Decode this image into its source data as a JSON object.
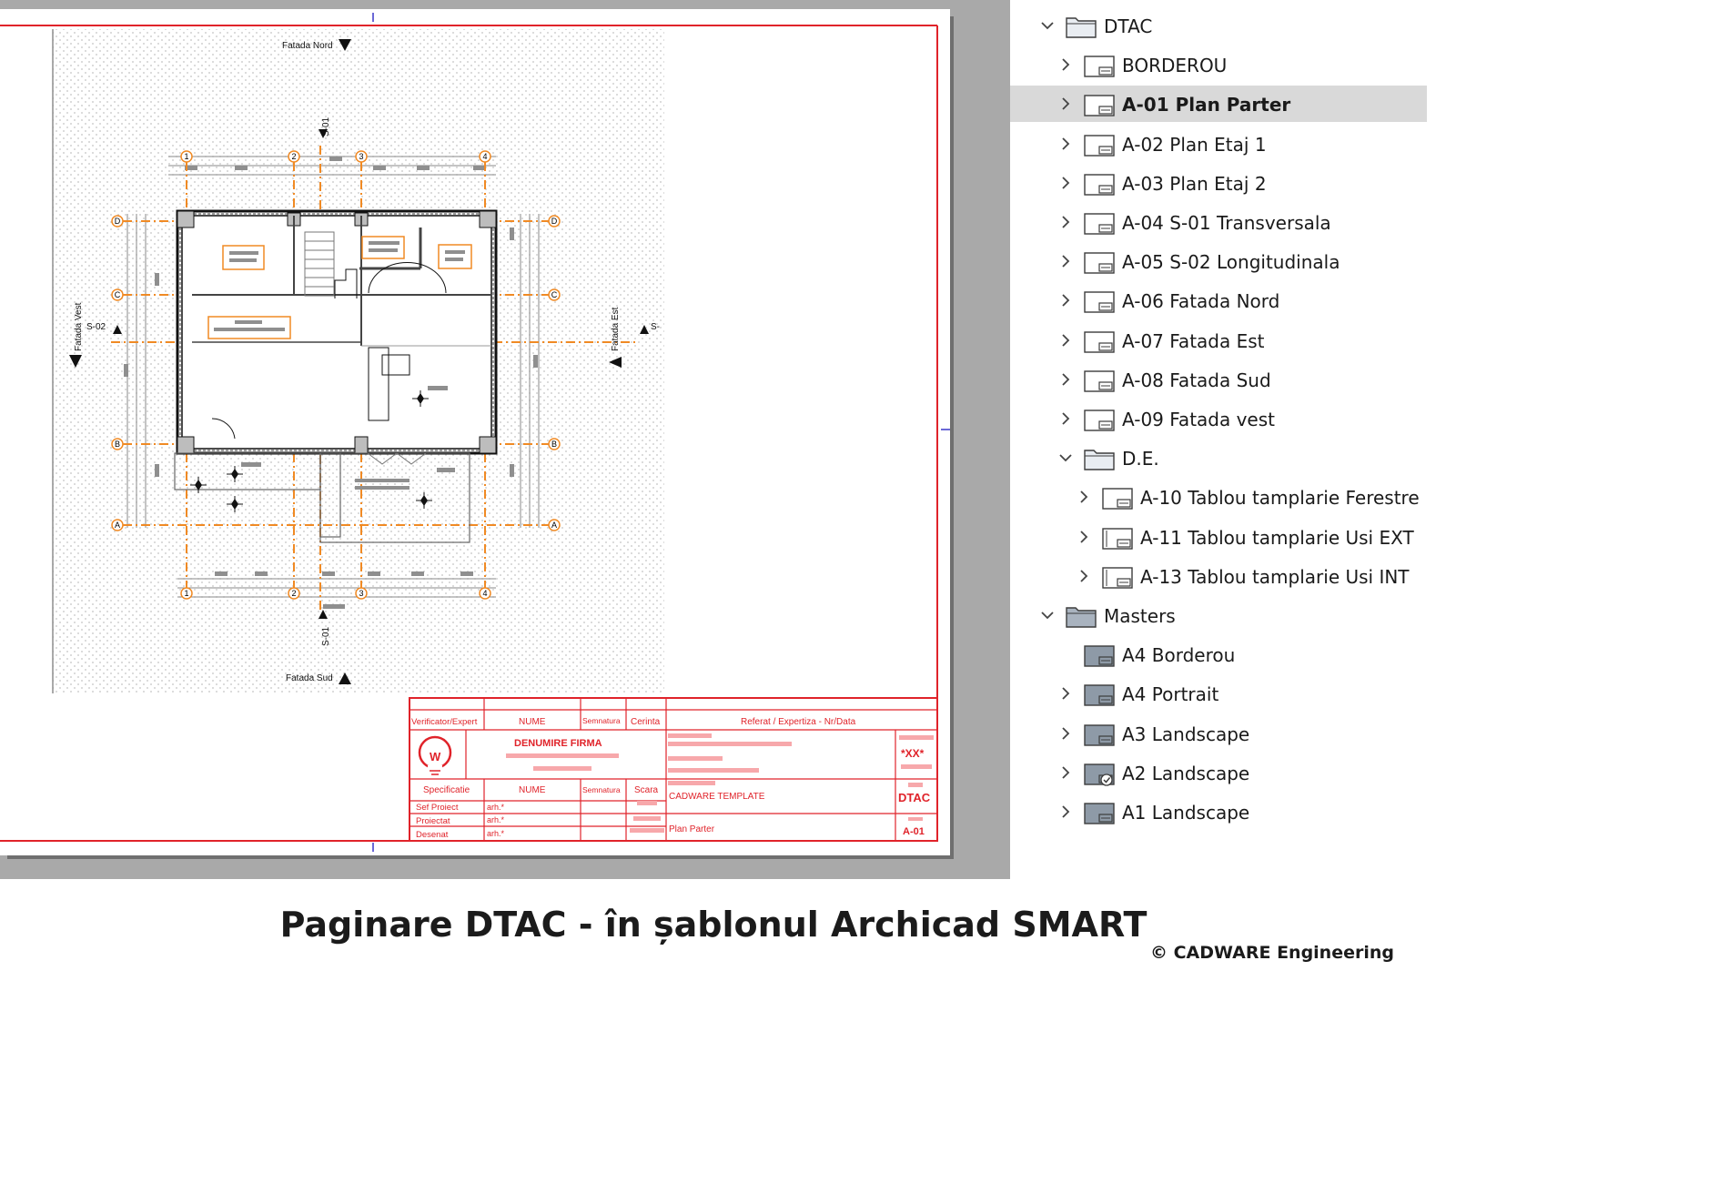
{
  "plan": {
    "elevations": {
      "north": "Fatada Nord",
      "south": "Fatada Sud",
      "east": "Fatada Est",
      "west": "Fatada Vest"
    },
    "sections": {
      "s01": "S-01",
      "s02": "S-02",
      "s_right": "S-"
    },
    "grid_numbers": [
      "1",
      "2",
      "3",
      "4"
    ],
    "grid_letters": [
      "A",
      "B",
      "C",
      "D"
    ]
  },
  "title_block": {
    "verificator": "Verificator/Expert",
    "nume": "NUME",
    "semnatura": "Semnatura",
    "cerinta": "Cerinta",
    "referat": "Referat / Expertiza - Nr/Data",
    "firm_name": "DENUMIRE FIRMA",
    "logo_letter": "W",
    "code": "*XX*",
    "specificatie": "Specificatie",
    "scara": "Scara",
    "template": "CADWARE TEMPLATE",
    "project_code": "DTAC",
    "roles": [
      {
        "role": "Sef Proiect",
        "name": "arh.*"
      },
      {
        "role": "Proiectat",
        "name": "arh.*"
      },
      {
        "role": "Desenat",
        "name": "arh.*"
      }
    ],
    "sheet_title": "Plan Parter",
    "sheet_number": "A-01"
  },
  "tree": [
    {
      "label": "DTAC",
      "icon": "folder-icon",
      "expanded": true,
      "selected": false
    },
    {
      "label": "BORDEROU",
      "icon": "layout-icon",
      "expanded": false,
      "selected": false
    },
    {
      "label": "A-01 Plan Parter",
      "icon": "layout-icon",
      "expanded": false,
      "selected": true
    },
    {
      "label": "A-02 Plan Etaj 1",
      "icon": "layout-icon",
      "expanded": false,
      "selected": false
    },
    {
      "label": "A-03 Plan Etaj 2",
      "icon": "layout-icon",
      "expanded": false,
      "selected": false
    },
    {
      "label": "A-04 S-01 Transversala",
      "icon": "layout-icon",
      "expanded": false,
      "selected": false
    },
    {
      "label": "A-05 S-02 Longitudinala",
      "icon": "layout-icon",
      "expanded": false,
      "selected": false
    },
    {
      "label": "A-06 Fatada Nord",
      "icon": "layout-icon",
      "expanded": false,
      "selected": false
    },
    {
      "label": "A-07 Fatada Est",
      "icon": "layout-icon",
      "expanded": false,
      "selected": false
    },
    {
      "label": "A-08 Fatada Sud",
      "icon": "layout-icon",
      "expanded": false,
      "selected": false
    },
    {
      "label": "A-09 Fatada vest",
      "icon": "layout-icon",
      "expanded": false,
      "selected": false
    },
    {
      "label": "D.E.",
      "icon": "folder-icon",
      "expanded": true,
      "selected": false
    },
    {
      "label": "A-10 Tablou tamplarie Ferestre",
      "icon": "layout-icon",
      "expanded": false,
      "selected": false
    },
    {
      "label": "A-11 Tablou tamplarie Usi EXT",
      "icon": "layout-icon-alt",
      "expanded": false,
      "selected": false
    },
    {
      "label": "A-13 Tablou tamplarie Usi INT",
      "icon": "layout-icon-alt",
      "expanded": false,
      "selected": false
    },
    {
      "label": "Masters",
      "icon": "folder-dark-icon",
      "expanded": true,
      "selected": false
    },
    {
      "label": "A4 Borderou",
      "icon": "master-icon",
      "expanded": false,
      "selected": false
    },
    {
      "label": "A4 Portrait",
      "icon": "master-icon",
      "expanded": false,
      "selected": false
    },
    {
      "label": "A3 Landscape",
      "icon": "master-icon",
      "expanded": false,
      "selected": false
    },
    {
      "label": "A2 Landscape",
      "icon": "master-check-icon",
      "expanded": false,
      "selected": false
    },
    {
      "label": "A1 Landscape",
      "icon": "master-icon",
      "expanded": false,
      "selected": false
    }
  ],
  "caption": "Paginare DTAC - în șablonul Archicad SMART",
  "copyright": "© CADWARE Engineering",
  "colors": {
    "border_red": "#e0232a",
    "axis_orange": "#f08a24",
    "guide_blue": "#6b68d6",
    "selected_row": "#d9d9d9"
  }
}
